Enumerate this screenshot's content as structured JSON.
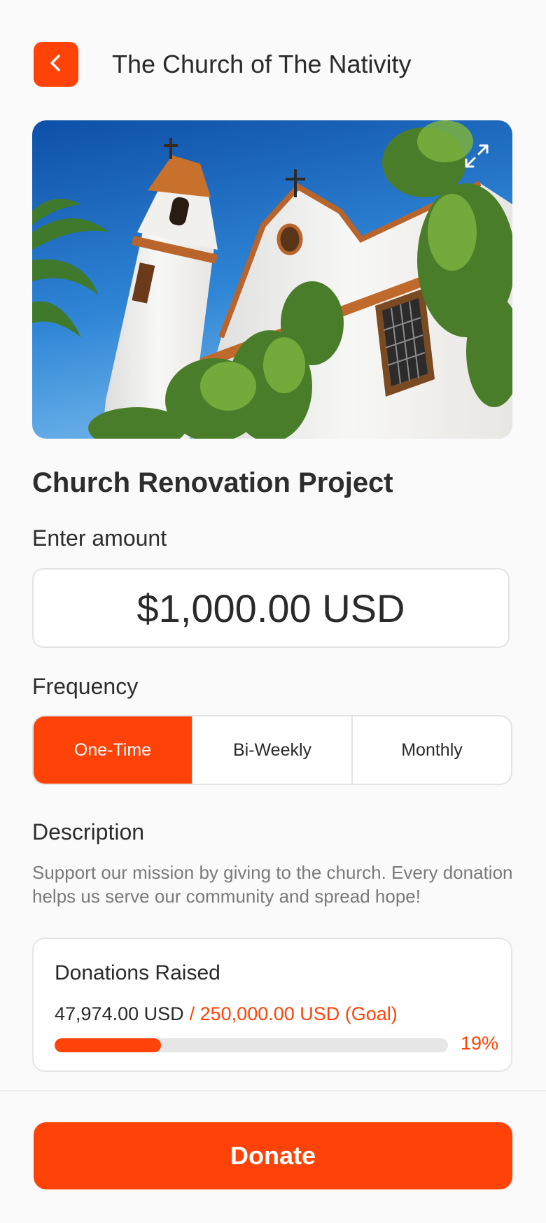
{
  "header": {
    "back_icon": "chevron-left-icon",
    "title": "The Church of The Nativity"
  },
  "hero": {
    "image_subject": "church-photo",
    "expand_icon": "expand-icon"
  },
  "project": {
    "title": "Church Renovation Project"
  },
  "amount": {
    "label": "Enter amount",
    "value": "$1,000.00 USD"
  },
  "frequency": {
    "label": "Frequency",
    "options": [
      "One-Time",
      "Bi-Weekly",
      "Monthly"
    ],
    "selected": "One-Time"
  },
  "description": {
    "label": "Description",
    "text": "Support our mission by giving to the church. Every donation helps us serve our community and spread hope!"
  },
  "donations": {
    "title": "Donations Raised",
    "raised": "47,974.00 USD",
    "goal": "/ 250,000.00 USD (Goal)",
    "percent_label": "19%",
    "progress_fraction": 0.19
  },
  "footer": {
    "donate_label": "Donate"
  },
  "colors": {
    "accent": "#ff4308",
    "text": "#2a2a2a",
    "muted": "#7a7a7a"
  }
}
